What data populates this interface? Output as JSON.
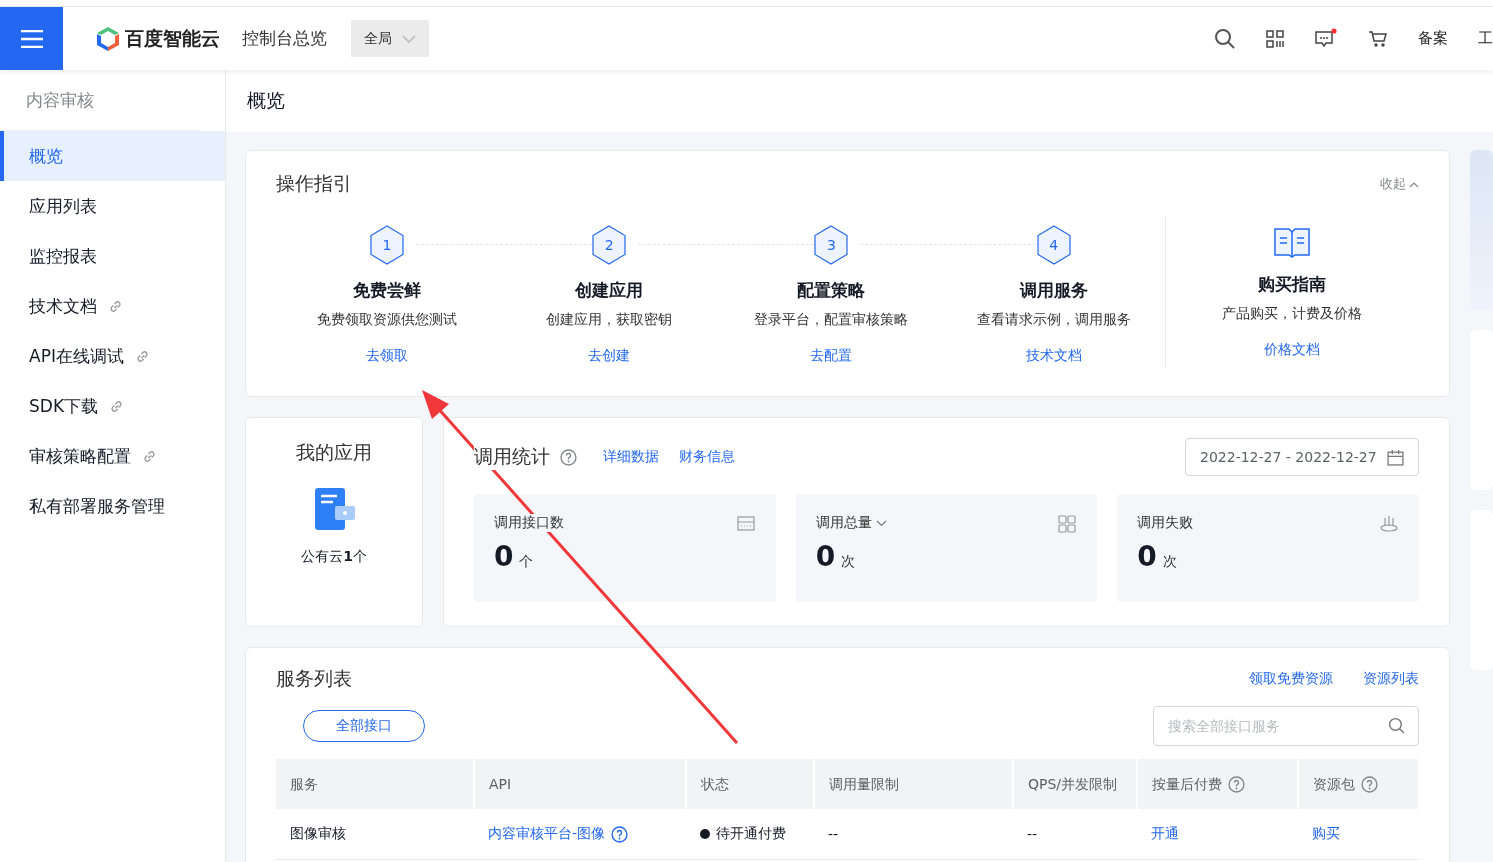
{
  "header": {
    "brand": "百度智能云",
    "console": "控制台总览",
    "region": {
      "label": "全局"
    },
    "actions": [
      "备案",
      "工"
    ]
  },
  "sidebar": {
    "title": "内容审核",
    "items": [
      {
        "label": "概览",
        "selected": true,
        "external": false
      },
      {
        "label": "应用列表",
        "selected": false,
        "external": false
      },
      {
        "label": "监控报表",
        "selected": false,
        "external": false
      },
      {
        "label": "技术文档",
        "selected": false,
        "external": true
      },
      {
        "label": "API在线调试",
        "selected": false,
        "external": true
      },
      {
        "label": "SDK下载",
        "selected": false,
        "external": true
      },
      {
        "label": "审核策略配置",
        "selected": false,
        "external": true
      },
      {
        "label": "私有部署服务管理",
        "selected": false,
        "external": false
      }
    ]
  },
  "page_title": "概览",
  "guide": {
    "title": "操作指引",
    "collapse": "收起",
    "steps": [
      {
        "number": "1",
        "title": "免费尝鲜",
        "desc": "免费领取资源供您测试",
        "link": "去领取"
      },
      {
        "number": "2",
        "title": "创建应用",
        "desc": "创建应用，获取密钥",
        "link": "去创建"
      },
      {
        "number": "3",
        "title": "配置策略",
        "desc": "登录平台，配置审核策略",
        "link": "去配置"
      },
      {
        "number": "4",
        "title": "调用服务",
        "desc": "查看请求示例，调用服务",
        "link": "技术文档"
      }
    ],
    "extra": {
      "title": "购买指南",
      "desc": "产品购买，计费及价格",
      "link": "价格文档"
    }
  },
  "my_apps": {
    "title": "我的应用",
    "label": "公有云**1**个"
  },
  "stats": {
    "title": "调用统计",
    "links": [
      "详细数据",
      "财务信息"
    ],
    "date_range": "2022-12-27 - 2022-12-27",
    "cards": [
      {
        "label": "调用接口数",
        "value": "0",
        "unit": "个",
        "dropdown": false
      },
      {
        "label": "调用总量",
        "value": "0",
        "unit": "次",
        "dropdown": true
      },
      {
        "label": "调用失败",
        "value": "0",
        "unit": "次",
        "dropdown": false
      }
    ]
  },
  "services": {
    "title": "服务列表",
    "links": [
      "领取免费资源",
      "资源列表"
    ],
    "filter": "全部接口",
    "search": {
      "placeholder": "搜索全部接口服务"
    },
    "columns": [
      {
        "label": "服务",
        "help": false
      },
      {
        "label": "API",
        "help": false
      },
      {
        "label": "状态",
        "help": false
      },
      {
        "label": "调用量限制",
        "help": false
      },
      {
        "label": "QPS/并发限制",
        "help": false
      },
      {
        "label": "按量后付费",
        "help": true
      },
      {
        "label": "资源包",
        "help": true
      }
    ],
    "rows": [
      {
        "service": "图像审核",
        "api": "内容审核平台-图像",
        "status": "待开通付费",
        "limit": "--",
        "qps": "--",
        "postpaid": "开通",
        "package": "购买"
      }
    ]
  }
}
